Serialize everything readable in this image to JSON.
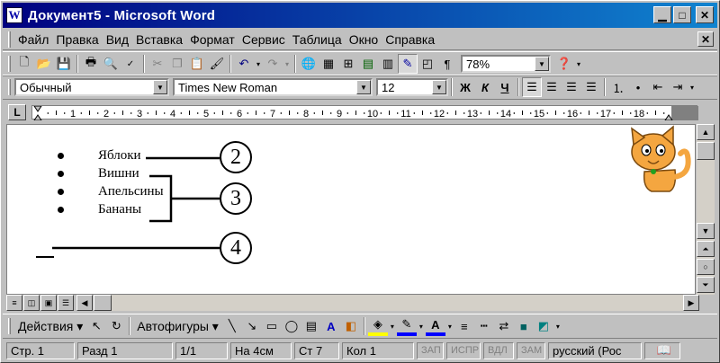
{
  "window": {
    "title": "Документ5 - Microsoft Word",
    "app_icon": "W"
  },
  "menu": [
    "Файл",
    "Правка",
    "Вид",
    "Вставка",
    "Формат",
    "Сервис",
    "Таблица",
    "Окно",
    "Справка"
  ],
  "toolbar": {
    "zoom": "78%"
  },
  "formatting": {
    "style": "Обычный",
    "font": "Times New Roman",
    "size": "12",
    "bold": "Ж",
    "italic": "К",
    "underline": "Ч"
  },
  "ruler": {
    "numbers": [
      "1",
      "2",
      "3",
      "4",
      "5",
      "6",
      "7",
      "8",
      "9",
      "10",
      "11",
      "12",
      "13",
      "14",
      "15",
      "16",
      "17",
      "18"
    ]
  },
  "document": {
    "items": [
      "Яблоки",
      "Вишни",
      "Апельсины",
      "Бананы"
    ]
  },
  "callouts": [
    "2",
    "3",
    "4"
  ],
  "drawing": {
    "actions": "Действия",
    "autoshapes": "Автофигуры"
  },
  "status": {
    "page": "Стр. 1",
    "section": "Разд 1",
    "pages": "1/1",
    "at": "На 4см",
    "line": "Ст 7",
    "col": "Кол 1",
    "rec": "ЗАП",
    "trk": "ИСПР",
    "ext": "ВДЛ",
    "ovr": "ЗАМ",
    "lang": "русский (Рос"
  }
}
